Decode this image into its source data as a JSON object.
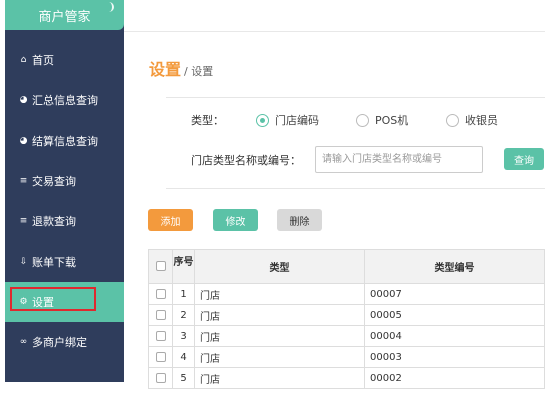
{
  "sidebar": {
    "brand": "商户管家",
    "items": [
      {
        "icon": "home-icon",
        "glyph": "⌂",
        "label": "首页"
      },
      {
        "icon": "pie-chart-icon",
        "glyph": "◕",
        "label": "汇总信息查询"
      },
      {
        "icon": "pie-chart-icon",
        "glyph": "◕",
        "label": "结算信息查询"
      },
      {
        "icon": "list-icon",
        "glyph": "≡",
        "label": "交易查询"
      },
      {
        "icon": "list-icon",
        "glyph": "≡",
        "label": "退款查询"
      },
      {
        "icon": "download-icon",
        "glyph": "⇩",
        "label": "账单下载"
      },
      {
        "icon": "gear-icon",
        "glyph": "⚙",
        "label": "设置",
        "active": true
      },
      {
        "icon": "link-icon",
        "glyph": "∞",
        "label": "多商户绑定"
      }
    ]
  },
  "breadcrumb": {
    "main": "设置",
    "sub": "/ 设置"
  },
  "filter": {
    "type_label": "类型：",
    "options": [
      {
        "label": "门店编码",
        "checked": true
      },
      {
        "label": "POS机",
        "checked": false
      },
      {
        "label": "收银员",
        "checked": false
      }
    ],
    "name_label": "门店类型名称或编号：",
    "search_placeholder": "请输入门店类型名称或编号",
    "search_value": "",
    "query_button": "查询"
  },
  "actions": {
    "add": "添加",
    "edit": "修改",
    "delete": "删除"
  },
  "table": {
    "headers": [
      "序号",
      "类型",
      "类型编号"
    ],
    "rows": [
      {
        "no": "1",
        "type": "门店",
        "code": "00007"
      },
      {
        "no": "2",
        "type": "门店",
        "code": "00005"
      },
      {
        "no": "3",
        "type": "门店",
        "code": "00004"
      },
      {
        "no": "4",
        "type": "门店",
        "code": "00003"
      },
      {
        "no": "5",
        "type": "门店",
        "code": "00002"
      }
    ]
  },
  "colors": {
    "accent": "#5bc2a7",
    "sidebar": "#2f3d5c",
    "orange": "#f39a3d",
    "highlight": "#e0282e"
  }
}
